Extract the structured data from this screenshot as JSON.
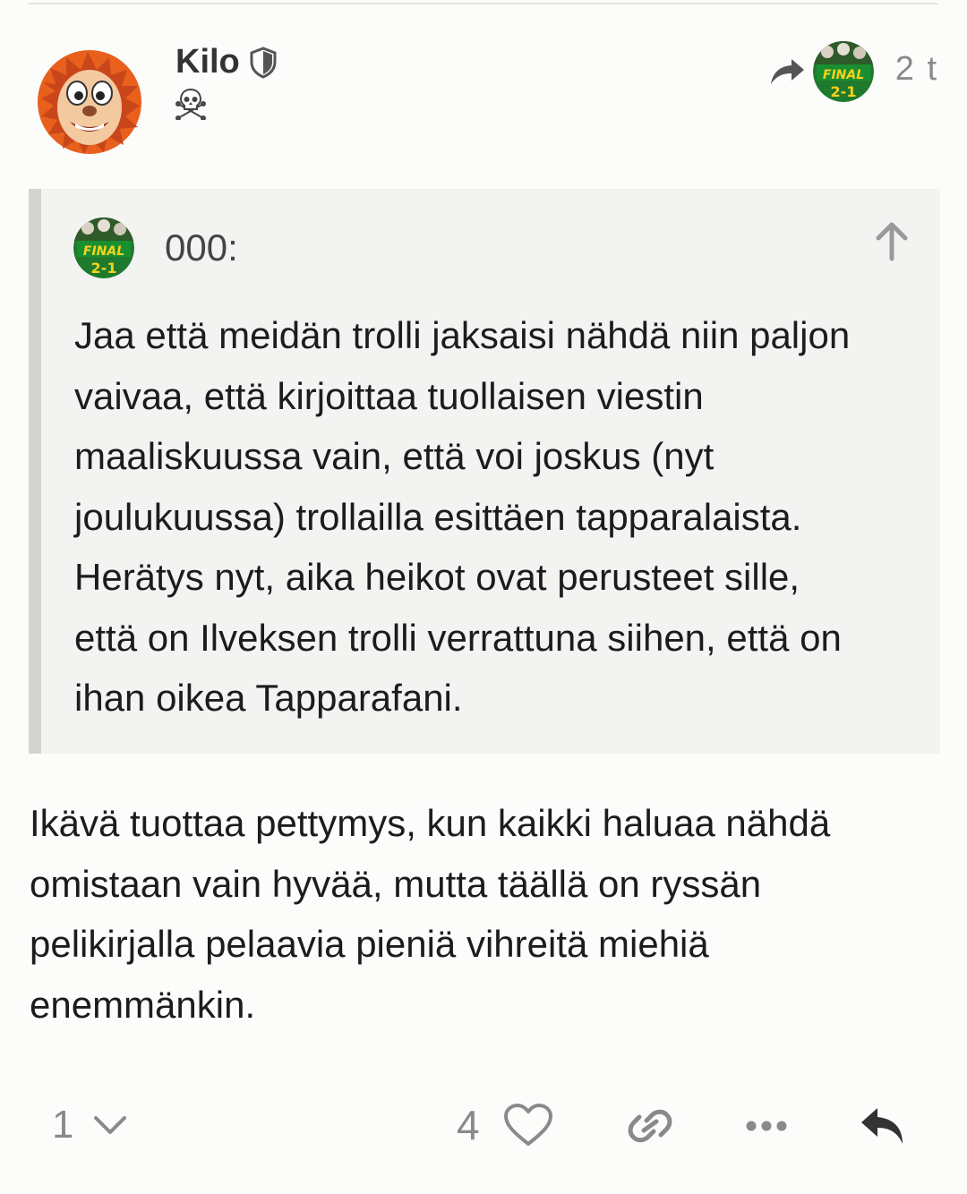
{
  "post": {
    "username": "Kilo",
    "date": "2 t",
    "reply_to_avatar": "ilves-team-avatar",
    "icons": {
      "moderator": "shield-icon",
      "flair": "skull-crossbones-icon",
      "reply_indicator": "share-arrow-icon"
    },
    "body": "Ikävä tuottaa pettymys, kun kaikki haluaa nähdä\nomistaan vain hyvää, mutta täällä on ryssän\npelikirjalla pelaavia pieniä vihreitä miehiä\nenemmänkin."
  },
  "quote": {
    "username": "000:",
    "body": "Jaa että meidän trolli jaksaisi nähdä niin paljon\nvaivaa, että kirjoittaa tuollaisen viestin\nmaaliskuussa vain, että voi joskus (nyt\njoulukuussa) trollailla esittäen tapparalaista.\nHerätys nyt, aika heikot ovat perusteet sille,\nettä on Ilveksen trolli verrattuna siihen, että on\nihan oikea Tapparafani.",
    "icons": {
      "jump": "arrow-up-icon"
    }
  },
  "actions": {
    "replies_count": "1",
    "likes_count": "4",
    "icons": [
      "chevron-down-icon",
      "heart-icon",
      "link-icon",
      "more-icon",
      "reply-icon"
    ]
  },
  "colors": {
    "background": "#fcfcfb",
    "quote_background": "#f3f3f2",
    "quote_border": "#d3d3d1",
    "muted": "#8a8a8a",
    "avatar_orange": "#e8601c",
    "team_green": "#1f7a2e"
  }
}
